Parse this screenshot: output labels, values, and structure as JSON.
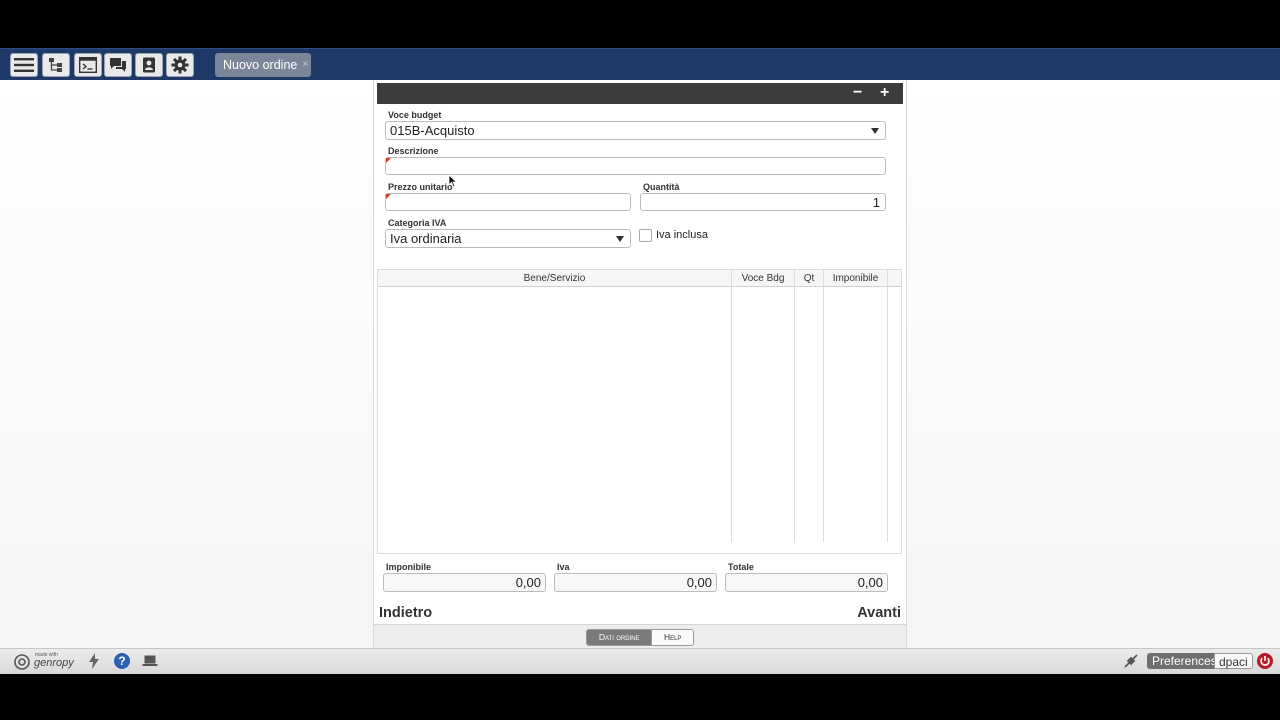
{
  "topbar": {
    "tab_label": "Nuovo ordine",
    "tab_close": "×",
    "icons": [
      "menu-icon",
      "tree-icon",
      "terminal-icon",
      "chat-icon",
      "contacts-icon",
      "gear-icon"
    ]
  },
  "panel": {
    "collapse": "−",
    "expand": "+"
  },
  "form": {
    "voce_budget": {
      "label": "Voce budget",
      "value": "015B-Acquisto"
    },
    "descrizione": {
      "label": "Descrizione",
      "value": ""
    },
    "prezzo": {
      "label": "Prezzo unitario",
      "value": ""
    },
    "quantita": {
      "label": "Quantità",
      "value": "1"
    },
    "categoria_iva": {
      "label": "Categoria IVA",
      "value": "Iva ordinaria"
    },
    "iva_inclusa": {
      "label": "Iva inclusa",
      "checked": false
    }
  },
  "grid": {
    "columns": [
      "Bene/Servizio",
      "Voce Bdg",
      "Qt",
      "Imponibile"
    ],
    "rows": []
  },
  "totals": {
    "imponibile": {
      "label": "Imponibile",
      "value": "0,00"
    },
    "iva": {
      "label": "Iva",
      "value": "0,00"
    },
    "totale": {
      "label": "Totale",
      "value": "0,00"
    }
  },
  "nav": {
    "back": "Indietro",
    "next": "Avanti"
  },
  "footer_tabs": {
    "dati": "Dati ordine",
    "help": "Help"
  },
  "bottombar": {
    "brand_small": "made with",
    "brand": "genropy",
    "preferences": "Preferences",
    "user": "dpaci"
  },
  "colors": {
    "topbar": "#1e3868",
    "panel_header": "#3c3c3c",
    "required_marker": "#d23d1e",
    "power": "#b71c2b"
  }
}
